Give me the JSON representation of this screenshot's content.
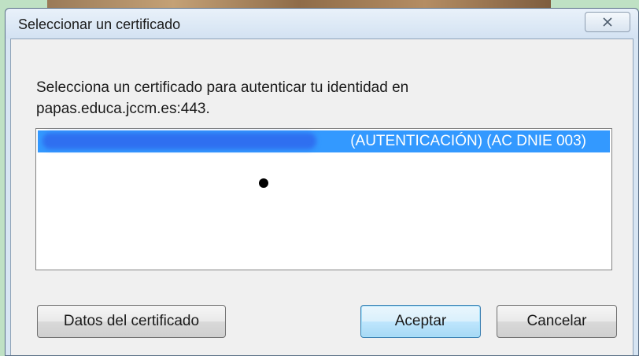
{
  "window": {
    "title": "Seleccionar un certificado",
    "close_icon": "close-x-icon"
  },
  "prompt": {
    "line1": "Selecciona un certificado para autenticar tu identidad en",
    "line2": "papas.educa.jccm.es:443."
  },
  "certificate_list": {
    "selected_item": {
      "visible_label": "(AUTENTICACIÓN) (AC DNIE 003)",
      "redacted": true
    },
    "selection_color": "#3399ff"
  },
  "buttons": {
    "details_label": "Datos del certificado",
    "accept_label": "Aceptar",
    "cancel_label": "Cancelar"
  },
  "colors": {
    "titlebar": "#d7e5f3",
    "client_background": "#f0f0f0",
    "default_button_border": "#3c7fb1"
  }
}
